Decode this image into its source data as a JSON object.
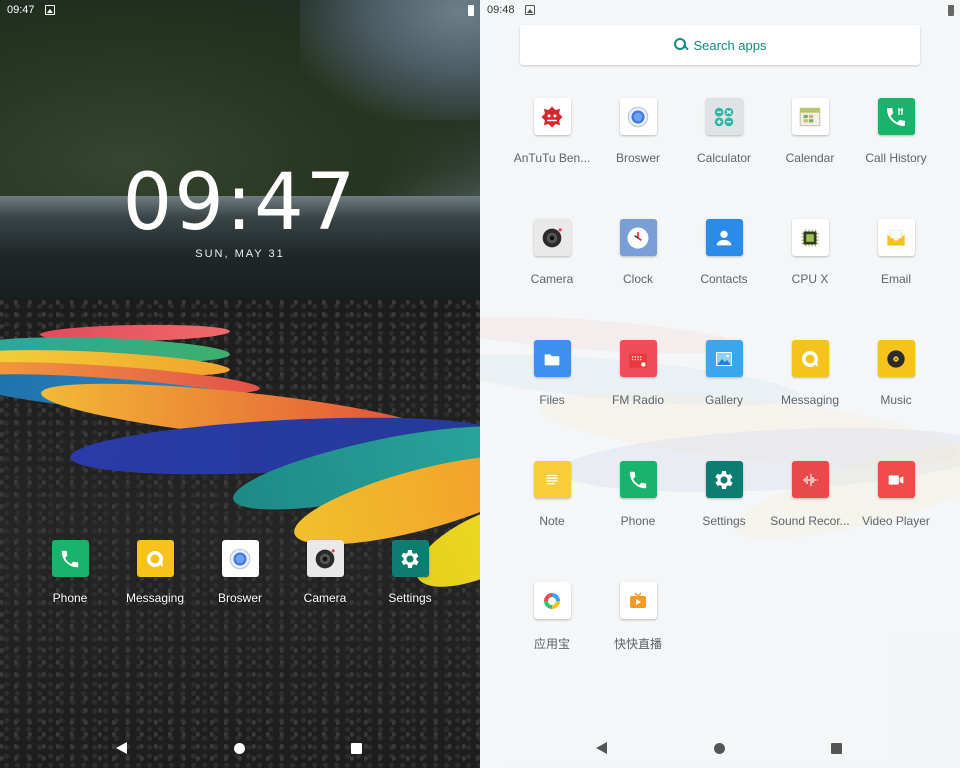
{
  "home": {
    "status_time": "09:47",
    "clock": "09:47",
    "date": "SUN, MAY 31",
    "dock": [
      {
        "label": "Phone",
        "icon": "phone-icon",
        "color": "#19b36b"
      },
      {
        "label": "Messaging",
        "icon": "messaging-icon",
        "color": "#f6c31c"
      },
      {
        "label": "Broswer",
        "icon": "browser-icon",
        "color": "#ffffff"
      },
      {
        "label": "Camera",
        "icon": "camera-icon",
        "color": "#ffffff"
      },
      {
        "label": "Settings",
        "icon": "settings-icon",
        "color": "#0e7d71"
      }
    ]
  },
  "drawer": {
    "status_time": "09:48",
    "search_placeholder": "Search apps",
    "accent": "#0f8a7e",
    "apps": [
      {
        "label": "AnTuTu Ben...",
        "icon": "antutu-icon"
      },
      {
        "label": "Broswer",
        "icon": "browser-icon"
      },
      {
        "label": "Calculator",
        "icon": "calculator-icon"
      },
      {
        "label": "Calendar",
        "icon": "calendar-icon"
      },
      {
        "label": "Call History",
        "icon": "call-history-icon"
      },
      {
        "label": "Camera",
        "icon": "camera-icon"
      },
      {
        "label": "Clock",
        "icon": "clock-icon"
      },
      {
        "label": "Contacts",
        "icon": "contacts-icon"
      },
      {
        "label": "CPU X",
        "icon": "cpu-icon"
      },
      {
        "label": "Email",
        "icon": "email-icon"
      },
      {
        "label": "Files",
        "icon": "files-icon"
      },
      {
        "label": "FM Radio",
        "icon": "radio-icon"
      },
      {
        "label": "Gallery",
        "icon": "gallery-icon"
      },
      {
        "label": "Messaging",
        "icon": "messaging-icon"
      },
      {
        "label": "Music",
        "icon": "music-icon"
      },
      {
        "label": "Note",
        "icon": "note-icon"
      },
      {
        "label": "Phone",
        "icon": "phone-icon"
      },
      {
        "label": "Settings",
        "icon": "settings-icon"
      },
      {
        "label": "Sound Recor...",
        "icon": "sound-recorder-icon"
      },
      {
        "label": "Video Player",
        "icon": "video-icon"
      },
      {
        "label": "应用宝",
        "icon": "app-store-icon"
      },
      {
        "label": "快快直播",
        "icon": "live-stream-icon"
      }
    ]
  }
}
